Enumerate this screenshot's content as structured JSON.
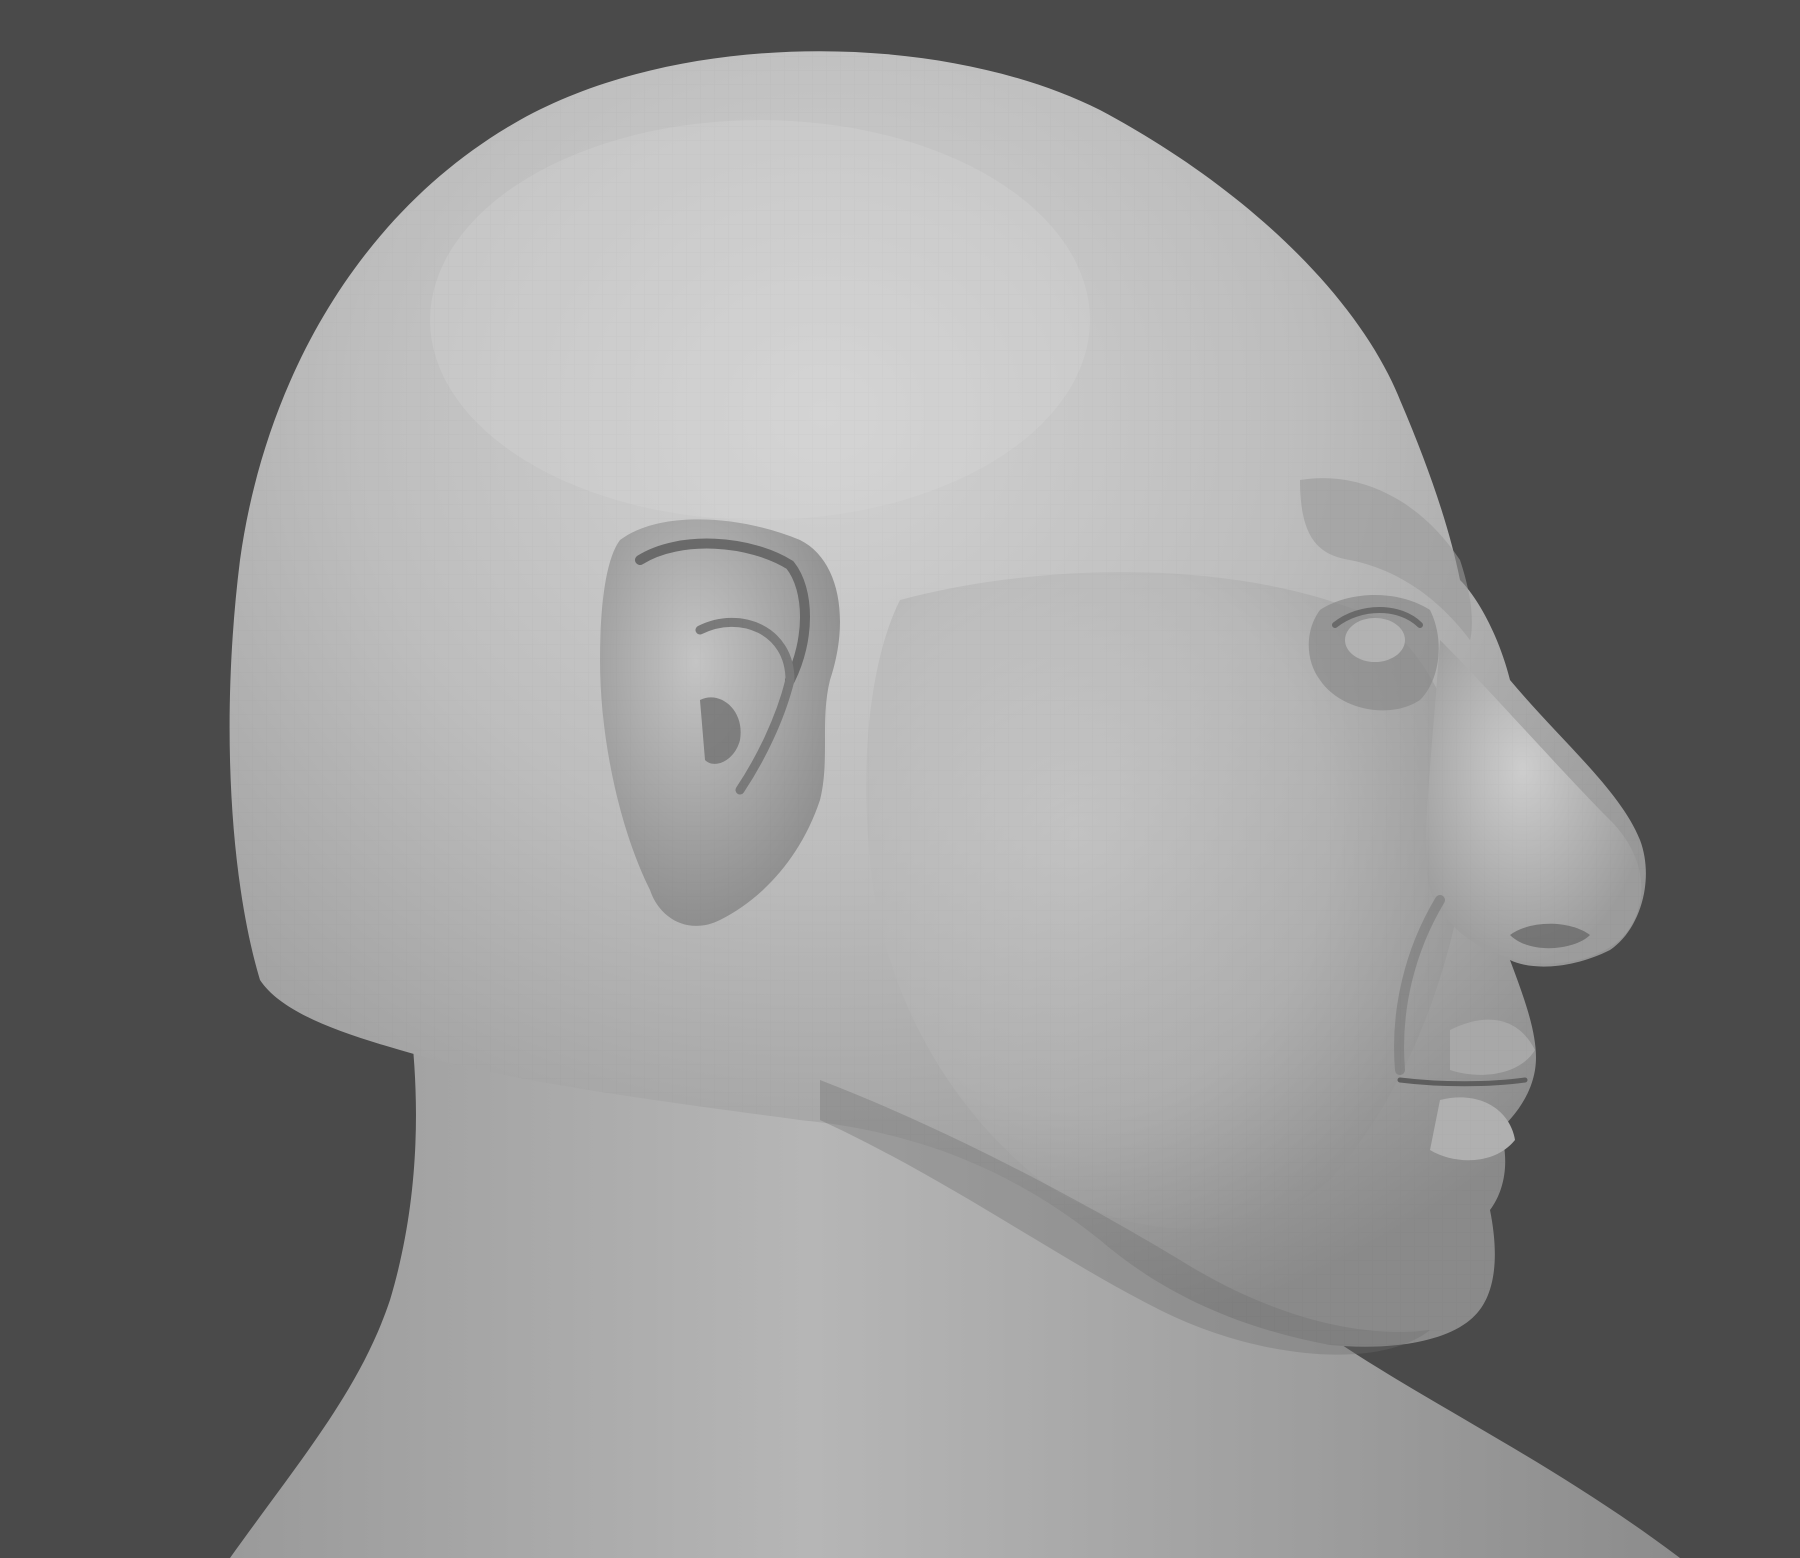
{
  "viewport": {
    "background_color": "#4a4a4a"
  },
  "model": {
    "subject": "sculpted-head-profile",
    "facing": "right",
    "material_base_color": "#b8b8b8",
    "material_highlight_color": "#d4d4d4",
    "material_shadow_color": "#6e6e6e"
  }
}
